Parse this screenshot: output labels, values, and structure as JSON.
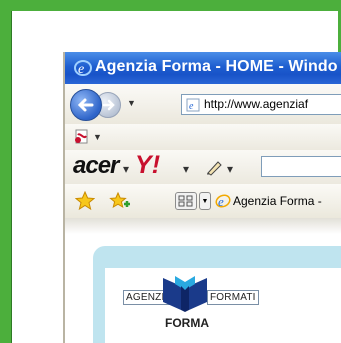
{
  "window": {
    "title": "Agenzia Forma - HOME - Windo"
  },
  "address_bar": {
    "url": "http://www.agenziaf"
  },
  "toolbar": {
    "brand": "acer",
    "yahoo": "Y",
    "yahoo_bang": "!"
  },
  "tabs": {
    "active_title": "Agenzia Forma -"
  },
  "page": {
    "logo_left": "AGENZIA",
    "logo_right": "FORMATI",
    "logo_bottom": "FORMA"
  },
  "colors": {
    "frame": "#4caf3c",
    "titlebar": "#1f5fd0",
    "page_panel": "#bfe4ef"
  },
  "icons": [
    "ie-icon",
    "back-icon",
    "forward-icon",
    "pdf-icon",
    "pencil-icon",
    "star-icon",
    "add-favorite-icon",
    "quick-tabs-icon",
    "forma-logo-icon"
  ]
}
